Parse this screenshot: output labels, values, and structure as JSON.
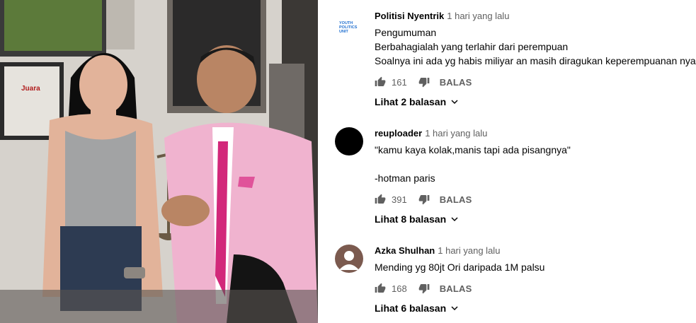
{
  "comments": [
    {
      "author": "Politisi Nyentrik",
      "time": "1 hari yang lalu",
      "avatar_text": "YOUTH POLITICS UNIT",
      "lines": [
        "Pengumuman",
        "Berbahagialah yang terlahir dari perempuan",
        "Soalnya ini ada yg habis miliyar an masih diragukan keperempuanan nya"
      ],
      "likes": "161",
      "reply_label": "BALAS",
      "view_replies": "Lihat 2 balasan"
    },
    {
      "author": "reuploader",
      "time": "1 hari yang lalu",
      "lines": [
        "\"kamu kaya kolak,manis tapi ada pisangnya\"",
        "",
        "-hotman paris"
      ],
      "likes": "391",
      "reply_label": "BALAS",
      "view_replies": "Lihat 8 balasan"
    },
    {
      "author": "Azka Shulhan",
      "time": "1 hari yang lalu",
      "lines": [
        "Mending yg 80jt Ori daripada 1M palsu"
      ],
      "likes": "168",
      "reply_label": "BALAS",
      "view_replies": "Lihat 6 balasan"
    }
  ],
  "video_poster_text": "Juara",
  "colors": {
    "text": "#030303",
    "secondary": "#606060",
    "avatar_blue": "#1f6fd0",
    "avatar_black": "#000000",
    "avatar_brown": "#7b5a4f",
    "suit_pink": "#f0b3cf",
    "tie_magenta": "#d2287a"
  }
}
